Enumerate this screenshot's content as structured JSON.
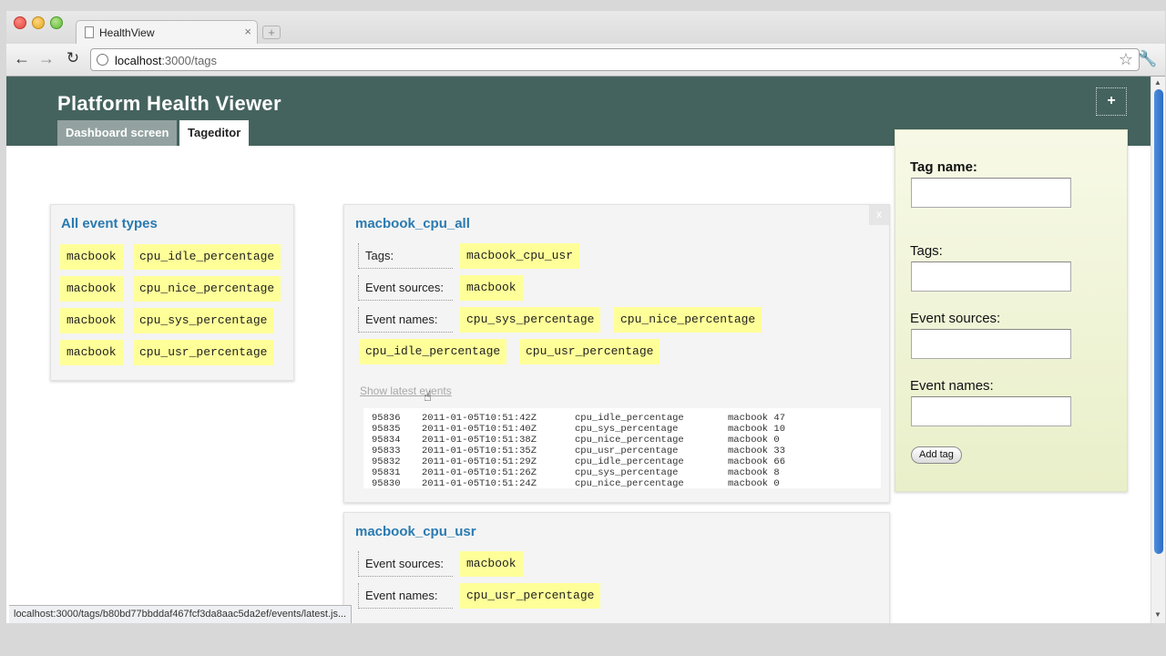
{
  "browser": {
    "tab_title": "HealthView",
    "tab_close": "×",
    "new_tab": "+",
    "url_host": "localhost",
    "url_path": ":3000/tags",
    "back_icon": "←",
    "forward_icon": "→",
    "reload_icon": "↻",
    "star_icon": "☆",
    "wrench_icon": "🔧",
    "status_url": "localhost:3000/tags/b80bd77bbddaf467fcf3da8aac5da2ef/events/latest.js..."
  },
  "app": {
    "title": "Platform Health Viewer",
    "add_label": "+",
    "nav": {
      "dashboard": "Dashboard screen",
      "tageditor": "Tageditor"
    },
    "colors": {
      "header": "#45635e",
      "title_link": "#2a7ab0",
      "chip": "#ffff99"
    }
  },
  "all_event_types": {
    "title": "All event types",
    "rows": [
      {
        "source": "macbook",
        "name": "cpu_idle_percentage"
      },
      {
        "source": "macbook",
        "name": "cpu_nice_percentage"
      },
      {
        "source": "macbook",
        "name": "cpu_sys_percentage"
      },
      {
        "source": "macbook",
        "name": "cpu_usr_percentage"
      }
    ]
  },
  "tag_all": {
    "title": "macbook_cpu_all",
    "close_label": "x",
    "tags_label": "Tags:",
    "tags": [
      "macbook_cpu_usr"
    ],
    "sources_label": "Event sources:",
    "sources": [
      "macbook"
    ],
    "names_label": "Event names:",
    "names": [
      "cpu_sys_percentage",
      "cpu_nice_percentage",
      "cpu_idle_percentage",
      "cpu_usr_percentage"
    ],
    "show_latest": "Show latest events",
    "events": [
      {
        "id": "95836",
        "time": "2011-01-05T10:51:42Z",
        "name": "cpu_idle_percentage",
        "source": "macbook 47"
      },
      {
        "id": "95835",
        "time": "2011-01-05T10:51:40Z",
        "name": "cpu_sys_percentage",
        "source": "macbook 10"
      },
      {
        "id": "95834",
        "time": "2011-01-05T10:51:38Z",
        "name": "cpu_nice_percentage",
        "source": "macbook 0"
      },
      {
        "id": "95833",
        "time": "2011-01-05T10:51:35Z",
        "name": "cpu_usr_percentage",
        "source": "macbook 33"
      },
      {
        "id": "95832",
        "time": "2011-01-05T10:51:29Z",
        "name": "cpu_idle_percentage",
        "source": "macbook 66"
      },
      {
        "id": "95831",
        "time": "2011-01-05T10:51:26Z",
        "name": "cpu_sys_percentage",
        "source": "macbook 8"
      },
      {
        "id": "95830",
        "time": "2011-01-05T10:51:24Z",
        "name": "cpu_nice_percentage",
        "source": "macbook 0"
      }
    ]
  },
  "tag_usr": {
    "title": "macbook_cpu_usr",
    "sources_label": "Event sources:",
    "sources": [
      "macbook"
    ],
    "names_label": "Event names:",
    "names": [
      "cpu_usr_percentage"
    ]
  },
  "form": {
    "tag_name_label": "Tag name:",
    "tags_label": "Tags:",
    "sources_label": "Event sources:",
    "names_label": "Event names:",
    "tag_name_value": "",
    "tags_value": "",
    "sources_value": "",
    "names_value": "",
    "submit_label": "Add tag"
  }
}
